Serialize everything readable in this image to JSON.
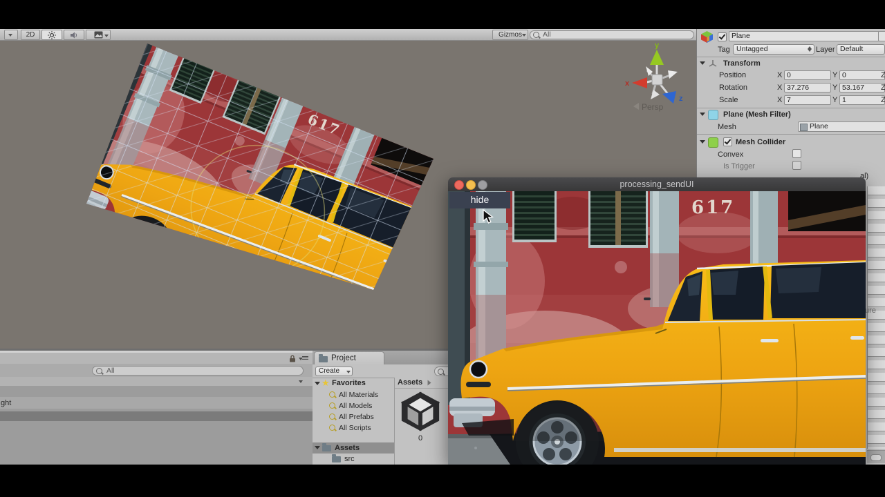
{
  "colors": {
    "accent_yellow": "#f2b114",
    "wall_red": "#9c3638",
    "scene_bg": "#7a756f",
    "panel_gray": "#c2c2c2",
    "title_bar": "#3e3e40",
    "hide_button": "#3a4150"
  },
  "scene_view": {
    "toolbar": {
      "mode_2d": "2D",
      "gizmos": "Gizmos",
      "search_value": "All"
    },
    "gizmo": {
      "axis_x": "x",
      "axis_y": "y",
      "axis_z": "z",
      "projection": "Persp"
    }
  },
  "inspector": {
    "object_name": "Plane",
    "tag_label": "Tag",
    "tag_value": "Untagged",
    "layer_label": "Layer",
    "layer_value": "Default",
    "axis": {
      "x": "X",
      "y": "Y",
      "z": "Z"
    },
    "transform": {
      "title": "Transform",
      "rows": [
        {
          "label": "Position",
          "x": "0",
          "y": "0"
        },
        {
          "label": "Rotation",
          "x": "37.276",
          "y": "53.167"
        },
        {
          "label": "Scale",
          "x": "7",
          "y": "1"
        }
      ]
    },
    "mesh_filter": {
      "title": "Plane (Mesh Filter)",
      "mesh_label": "Mesh",
      "mesh_value": "Plane"
    },
    "mesh_collider": {
      "title": "Mesh Collider",
      "convex_label": "Convex",
      "trigger_label": "Is Trigger",
      "material_partial": "al)",
      "texture_partial": "ture"
    }
  },
  "project_panel": {
    "tab": "Project",
    "create_button": "Create",
    "favorites": "Favorites",
    "favorite_items": [
      "All Materials",
      "All Models",
      "All Prefabs",
      "All Scripts"
    ],
    "assets_folder": "Assets",
    "src_folder": "src",
    "breadcrumb": "Assets",
    "asset_label": "0"
  },
  "left_panel": {
    "search_value": "All",
    "row_text": "ght"
  },
  "processing_window": {
    "title": "processing_sendUI",
    "hide_button": "hide"
  },
  "photo": {
    "street_number": "617"
  }
}
